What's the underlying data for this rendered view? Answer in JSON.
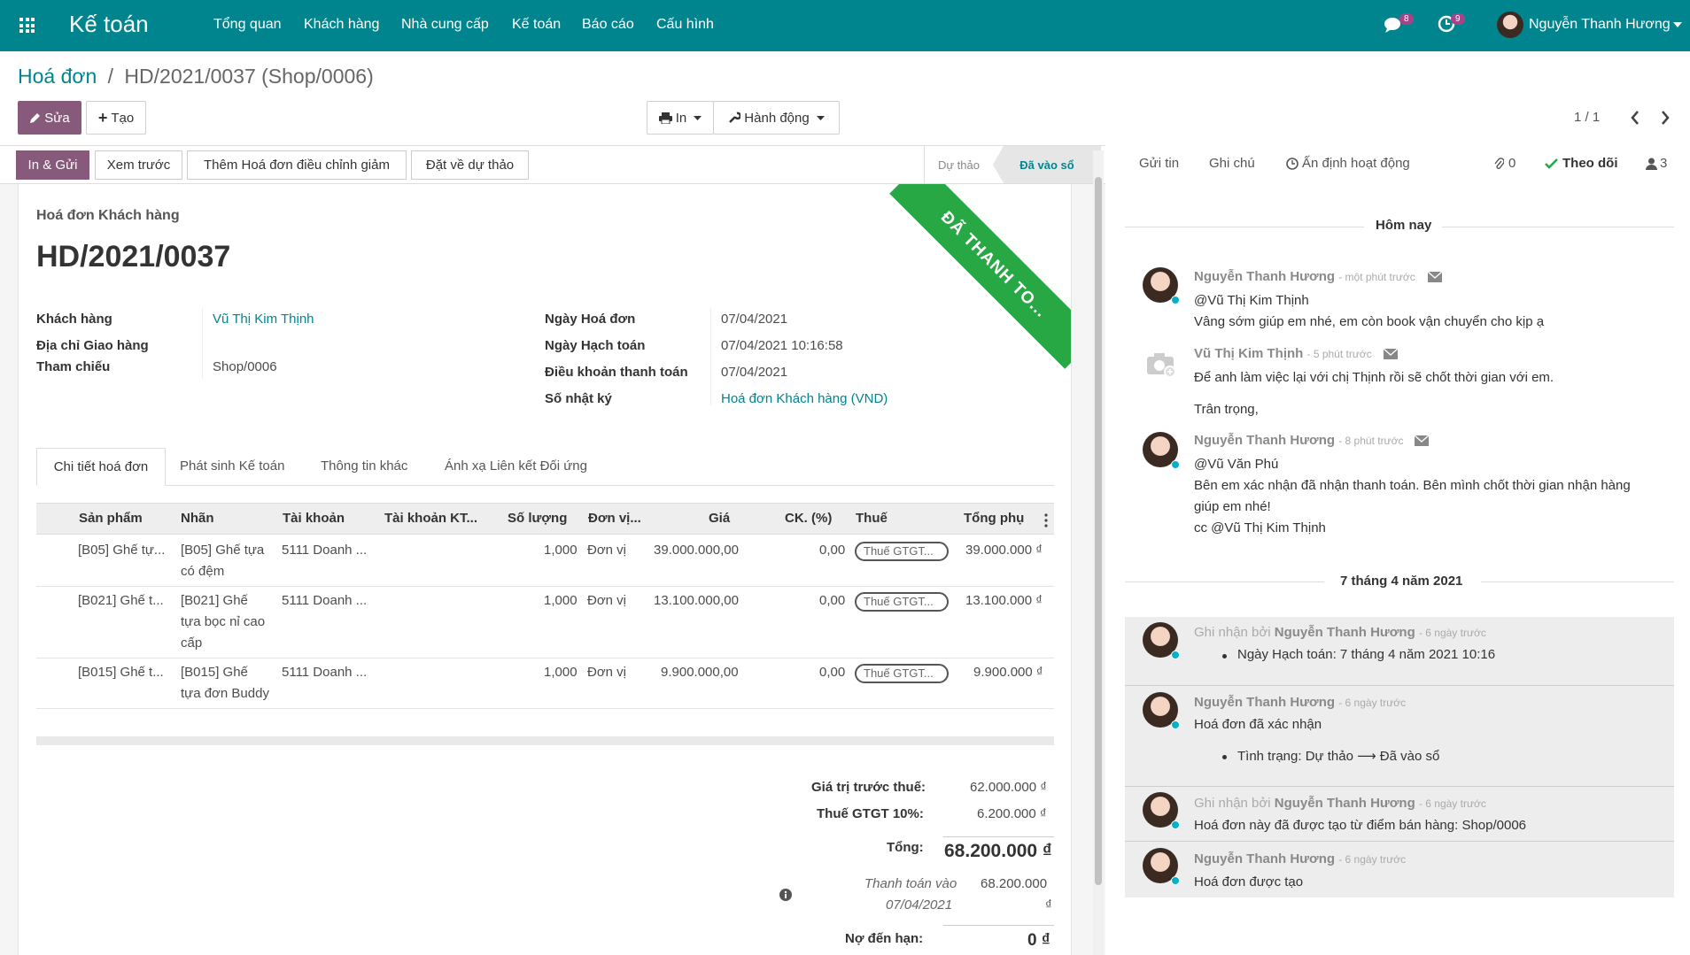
{
  "navbar": {
    "app_title": "Kế toán",
    "menu": [
      "Tổng quan",
      "Khách hàng",
      "Nhà cung cấp",
      "Kế toán",
      "Báo cáo",
      "Cấu hình"
    ],
    "messages_count": "8",
    "activities_count": "9",
    "user_name": "Nguyễn Thanh Hương"
  },
  "breadcrumb": {
    "parent": "Hoá đơn",
    "separator": "/",
    "current": "HD/2021/0037 (Shop/0006)"
  },
  "control": {
    "edit_label": "Sửa",
    "create_label": "Tạo",
    "print_label": "In",
    "action_label": "Hành động",
    "pager": "1 / 1"
  },
  "statusbar": {
    "buttons": [
      "In & Gửi",
      "Xem trước",
      "Thêm Hoá đơn điều chỉnh giảm",
      "Đặt về dự thảo"
    ],
    "states": [
      "Dự thảo",
      "Đã vào sổ"
    ]
  },
  "ribbon": "ĐÃ THANH TO...",
  "invoice": {
    "type_label": "Hoá đơn Khách hàng",
    "number": "HD/2021/0037",
    "left_fields": [
      {
        "label": "Khách hàng",
        "value": "Vũ Thị Kim Thịnh"
      },
      {
        "label": "Địa chỉ Giao hàng",
        "value": ""
      },
      {
        "label": "Tham chiếu",
        "value": "Shop/0006"
      }
    ],
    "right_fields": [
      {
        "label": "Ngày Hoá đơn",
        "value": "07/04/2021"
      },
      {
        "label": "Ngày Hạch toán",
        "value": "07/04/2021 10:16:58"
      },
      {
        "label": "Điều khoản thanh toán",
        "value": "07/04/2021"
      },
      {
        "label": "Số nhật ký",
        "value": "Hoá đơn Khách hàng (VND)"
      }
    ]
  },
  "tabs": [
    "Chi tiết hoá đơn",
    "Phát sinh Kế toán",
    "Thông tin khác",
    "Ánh xạ Liên kết Đối ứng"
  ],
  "table": {
    "headers": [
      "Sản phẩm",
      "Nhãn",
      "Tài khoản",
      "Tài khoản KT...",
      "Số lượng",
      "Đơn vị...",
      "Giá",
      "CK. (%)",
      "Thuế",
      "Tổng phụ"
    ],
    "rows": [
      {
        "product": "[B05] Ghế tự...",
        "label1": "[B05] Ghế tựa",
        "label2": "có đệm",
        "label3": "",
        "account": "5111 Doanh ...",
        "qty": "1,000",
        "uom": "Đơn vị",
        "price": "39.000.000,00",
        "disc": "0,00",
        "tax": "Thuế GTGT...",
        "subtotal": "39.000.000 ₫"
      },
      {
        "product": "[B021] Ghế t...",
        "label1": "[B021] Ghế",
        "label2": "tựa bọc nỉ cao",
        "label3": "cấp",
        "account": "5111 Doanh ...",
        "qty": "1,000",
        "uom": "Đơn vị",
        "price": "13.100.000,00",
        "disc": "0,00",
        "tax": "Thuế GTGT...",
        "subtotal": "13.100.000 ₫"
      },
      {
        "product": "[B015] Ghế t...",
        "label1": "[B015] Ghế",
        "label2": "tựa đơn Buddy",
        "label3": "",
        "account": "5111 Doanh ...",
        "qty": "1,000",
        "uom": "Đơn vị",
        "price": "9.900.000,00",
        "disc": "0,00",
        "tax": "Thuế GTGT...",
        "subtotal": "9.900.000 ₫"
      }
    ]
  },
  "totals": {
    "untaxed_label": "Giá trị trước thuế:",
    "untaxed": "62.000.000 ₫",
    "vat_label": "Thuế GTGT 10%:",
    "vat": "6.200.000 ₫",
    "total_label": "Tổng:",
    "total": "68.200.000 ₫",
    "paid_label1": "Thanh toán vào",
    "paid_label2": "07/04/2021",
    "paid_value1": "68.200.000",
    "paid_value2": "₫",
    "due_label": "Nợ đến hạn:",
    "due": "0 ₫"
  },
  "chatter": {
    "send_message": "Gửi tin",
    "log_note": "Ghi chú",
    "schedule_activity": "Ấn định hoạt động",
    "attachments": "0",
    "follow": "Theo dõi",
    "followers": "3",
    "today": "Hôm nay",
    "date_sep": "7 tháng 4 năm 2021",
    "messages": [
      {
        "author": "Nguyễn Thanh Hương",
        "time": "- một phút trước",
        "lines": [
          "@Vũ Thị Kim Thịnh",
          "Vâng sớm giúp em nhé, em còn book vận chuyển cho kịp ạ"
        ]
      },
      {
        "author": "Vũ Thị Kim Thịnh",
        "time": "- 5 phút trước",
        "lines": [
          "Để anh làm việc lại với chị Thịnh rồi sẽ chốt thời gian với em.",
          "Trân trọng,"
        ]
      },
      {
        "author": "Nguyễn Thanh Hương",
        "time": "- 8 phút trước",
        "lines": [
          "@Vũ Văn Phú",
          "Bên em xác nhận đã nhận thanh toán. Bên mình chốt thời gian nhận hàng",
          "giúp em nhé!",
          "cc @Vũ Thị Kim Thịnh"
        ]
      }
    ],
    "notes": [
      {
        "prefix": "Ghi nhận bởi",
        "author": "Nguyễn Thanh Hương",
        "time": "- 6 ngày trước",
        "body": "Ngày Hạch toán: 7 tháng 4 năm 2021 10:16"
      },
      {
        "prefix": "",
        "author": "Nguyễn Thanh Hương",
        "time": "- 6 ngày trước",
        "body": "Hoá đơn đã xác nhận",
        "bullet": "Tình trạng: Dự thảo ⟶ Đã vào sổ"
      },
      {
        "prefix": "Ghi nhận bởi",
        "author": "Nguyễn Thanh Hương",
        "time": "- 6 ngày trước",
        "body": "Hoá đơn này đã được tạo từ điểm bán hàng: Shop/0006"
      },
      {
        "prefix": "",
        "author": "Nguyễn Thanh Hương",
        "time": "- 6 ngày trước",
        "body": "Hoá đơn được tạo"
      }
    ]
  },
  "colors": {
    "brand": "#00858f",
    "primary": "#875a7b",
    "ribbon": "#28a745"
  }
}
